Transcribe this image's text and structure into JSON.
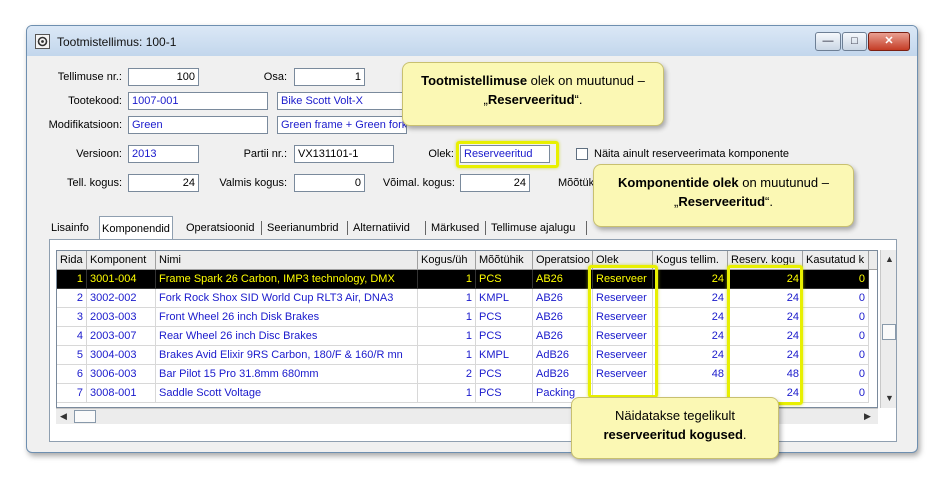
{
  "window": {
    "title": "Tootmistellimus: 100-1",
    "buttons": {
      "min": "—",
      "max": "□",
      "close": "✕"
    }
  },
  "form": {
    "tellimuse_nr": {
      "label": "Tellimuse nr.:",
      "value": "100"
    },
    "osa": {
      "label": "Osa:",
      "value": "1"
    },
    "tootekood": {
      "label": "Tootekood:",
      "value": "1007-001",
      "name": "Bike Scott Volt-X"
    },
    "modifikatsioon": {
      "label": "Modifikatsioon:",
      "value": "Green",
      "name": "Green frame + Green fork"
    },
    "versioon": {
      "label": "Versioon:",
      "value": "2013"
    },
    "partii_nr": {
      "label": "Partii nr.:",
      "value": "VX131101-1"
    },
    "olek": {
      "label": "Olek:",
      "value": "Reserveeritud"
    },
    "checkbox_label": "Näita ainult reserveerimata komponente",
    "tell_kogus": {
      "label": "Tell. kogus:",
      "value": "24"
    },
    "valmis_kogus": {
      "label": "Valmis kogus:",
      "value": "0"
    },
    "voimal_kogus": {
      "label": "Võimal. kogus:",
      "value": "24"
    },
    "mootuhik_label": "Mõõtük"
  },
  "tabs": [
    "Lisainfo",
    "Komponendid",
    "Operatsioonid",
    "Seerianumbrid",
    "Alternatiivid",
    "Märkused",
    "Tellimuse ajalugu"
  ],
  "grid": {
    "headers": [
      "Rida",
      "Komponent",
      "Nimi",
      "Kogus/üh",
      "Mõõtühik",
      "Operatsioo",
      "Olek",
      "Kogus tellim.",
      "Reserv. kogu",
      "Kasutatud k"
    ],
    "rows": [
      [
        "1",
        "3001-004",
        "Frame Spark 26 Carbon, IMP3 technology, DMX",
        "1",
        "PCS",
        "AB26",
        "Reserveer",
        "24",
        "24",
        "0"
      ],
      [
        "2",
        "3002-002",
        "Fork Rock Shox SID World Cup RLT3 Air, DNA3",
        "1",
        "KMPL",
        "AB26",
        "Reserveer",
        "24",
        "24",
        "0"
      ],
      [
        "3",
        "2003-003",
        "Front Wheel 26 inch Disk Brakes",
        "1",
        "PCS",
        "AB26",
        "Reserveer",
        "24",
        "24",
        "0"
      ],
      [
        "4",
        "2003-007",
        "Rear Wheel 26 inch Disc Brakes",
        "1",
        "PCS",
        "AB26",
        "Reserveer",
        "24",
        "24",
        "0"
      ],
      [
        "5",
        "3004-003",
        "Brakes Avid Elixir 9RS Carbon, 180/F & 160/R mn",
        "1",
        "KMPL",
        "AdB26",
        "Reserveer",
        "24",
        "24",
        "0"
      ],
      [
        "6",
        "3006-003",
        "Bar Pilot 15 Pro 31.8mm 680mm",
        "2",
        "PCS",
        "AdB26",
        "Reserveer",
        "48",
        "48",
        "0"
      ],
      [
        "7",
        "3008-001",
        "Saddle Scott Voltage",
        "1",
        "PCS",
        "Packing",
        "",
        "",
        "24",
        "0"
      ]
    ]
  },
  "callouts": {
    "c1": {
      "bold": "Tootmistellimuse",
      "mid": " olek on muutunud  – „",
      "bold2": "Reserveeritud",
      "end": "“."
    },
    "c2": {
      "bold": "Komponentide olek",
      "mid": " on muutunud  – „",
      "bold2": "Reserveeritud",
      "end": "“."
    },
    "c3": {
      "line1": "Näidatakse tegelikult",
      "bold": "reserveeritud kogused",
      "end": "."
    }
  },
  "colors": {
    "highlight": "#e8f000",
    "callout_bg": "#fbf8b4",
    "cell_text": "#1a1acc",
    "selected_row_text": "#ffff00"
  }
}
